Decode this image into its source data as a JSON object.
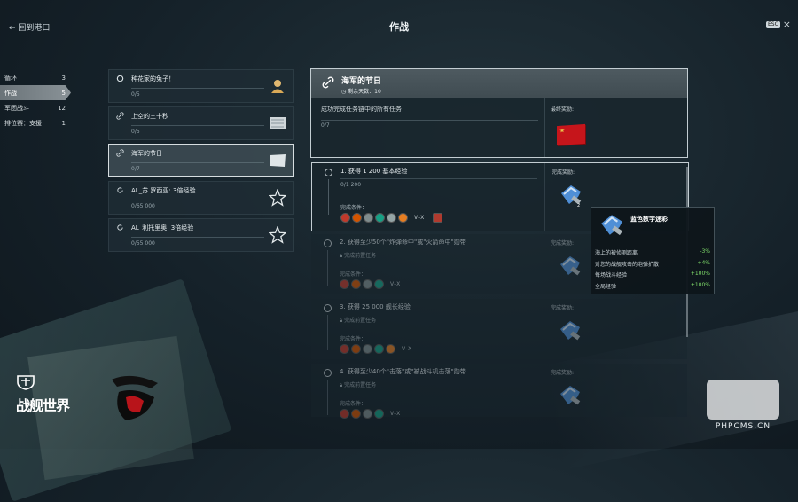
{
  "header": {
    "back_label": "回到港口",
    "title": "作战",
    "esc_badge": "ESC",
    "close_glyph": "×"
  },
  "sidebar": {
    "items": [
      {
        "label": "循环",
        "count": "3",
        "active": false
      },
      {
        "label": "作战",
        "count": "5",
        "active": true
      },
      {
        "label": "军团战斗",
        "count": "12",
        "active": false
      },
      {
        "label": "排位赛：支援",
        "count": "1",
        "active": false
      }
    ]
  },
  "quests": [
    {
      "name": "种花家的兔子！",
      "progress": "0/5",
      "icon": "circle-icon",
      "reward_icon": "commander-bust-icon",
      "active": false
    },
    {
      "name": "上空的三十秒",
      "progress": "0/5",
      "icon": "link-icon",
      "reward_icon": "flag-icon",
      "active": false
    },
    {
      "name": "海军的节日",
      "progress": "0/7",
      "icon": "link-icon",
      "reward_icon": "flag-icon",
      "active": true
    },
    {
      "name": "AL_苏.罗西亚: 3倍经验",
      "progress": "0/65 000",
      "icon": "refresh-icon",
      "reward_icon": "star-icon",
      "active": false
    },
    {
      "name": "AL_利托里奥: 3倍经验",
      "progress": "0/55 000",
      "icon": "refresh-icon",
      "reward_icon": "star-icon",
      "active": false
    }
  ],
  "detail": {
    "name": "海军的节日",
    "time_left": "剩余天数：10",
    "description": "成功完成任务链中的所有任务",
    "progress": "0/7",
    "final_reward_label": "最终奖励:"
  },
  "tasks": [
    {
      "title": "1. 获得 1 200 基本经验",
      "progress": "0/1 200",
      "locked": false,
      "cond_label": "完成条件：",
      "tier": "V–X",
      "reward_label": "完成奖励:"
    },
    {
      "title": "2. 获得至少50个\"炸弹命中\"或\"火箭命中\"勋带",
      "lock_text": "完成前置任务",
      "locked": true,
      "cond_label": "完成条件：",
      "tier": "V–X",
      "reward_label": "完成奖励:"
    },
    {
      "title": "3. 获得 25 000 舰长经验",
      "lock_text": "完成前置任务",
      "locked": true,
      "cond_label": "完成条件：",
      "tier": "V–X",
      "reward_label": "完成奖励:"
    },
    {
      "title": "4. 获得至少40个\"击落\"或\"被战斗机击落\"勋带",
      "lock_text": "完成前置任务",
      "locked": true,
      "cond_label": "完成条件：",
      "tier": "V–X",
      "reward_label": "完成奖励:"
    }
  ],
  "tooltip": {
    "title": "蓝色数字迷彩",
    "rows": [
      {
        "label": "海上的被侦测距离",
        "value": "-3%"
      },
      {
        "label": "对您的战舰攻击的泡弹扩散",
        "value": "+4%"
      },
      {
        "label": "每场战斗经验",
        "value": "+100%"
      },
      {
        "label": "全局经验",
        "value": "+100%"
      }
    ]
  },
  "logos": {
    "game": "战舰世界",
    "site_text": "PHPCMS.CN"
  },
  "colors": {
    "accent_flag": "#c6151b",
    "positive": "#7fdc6a"
  }
}
